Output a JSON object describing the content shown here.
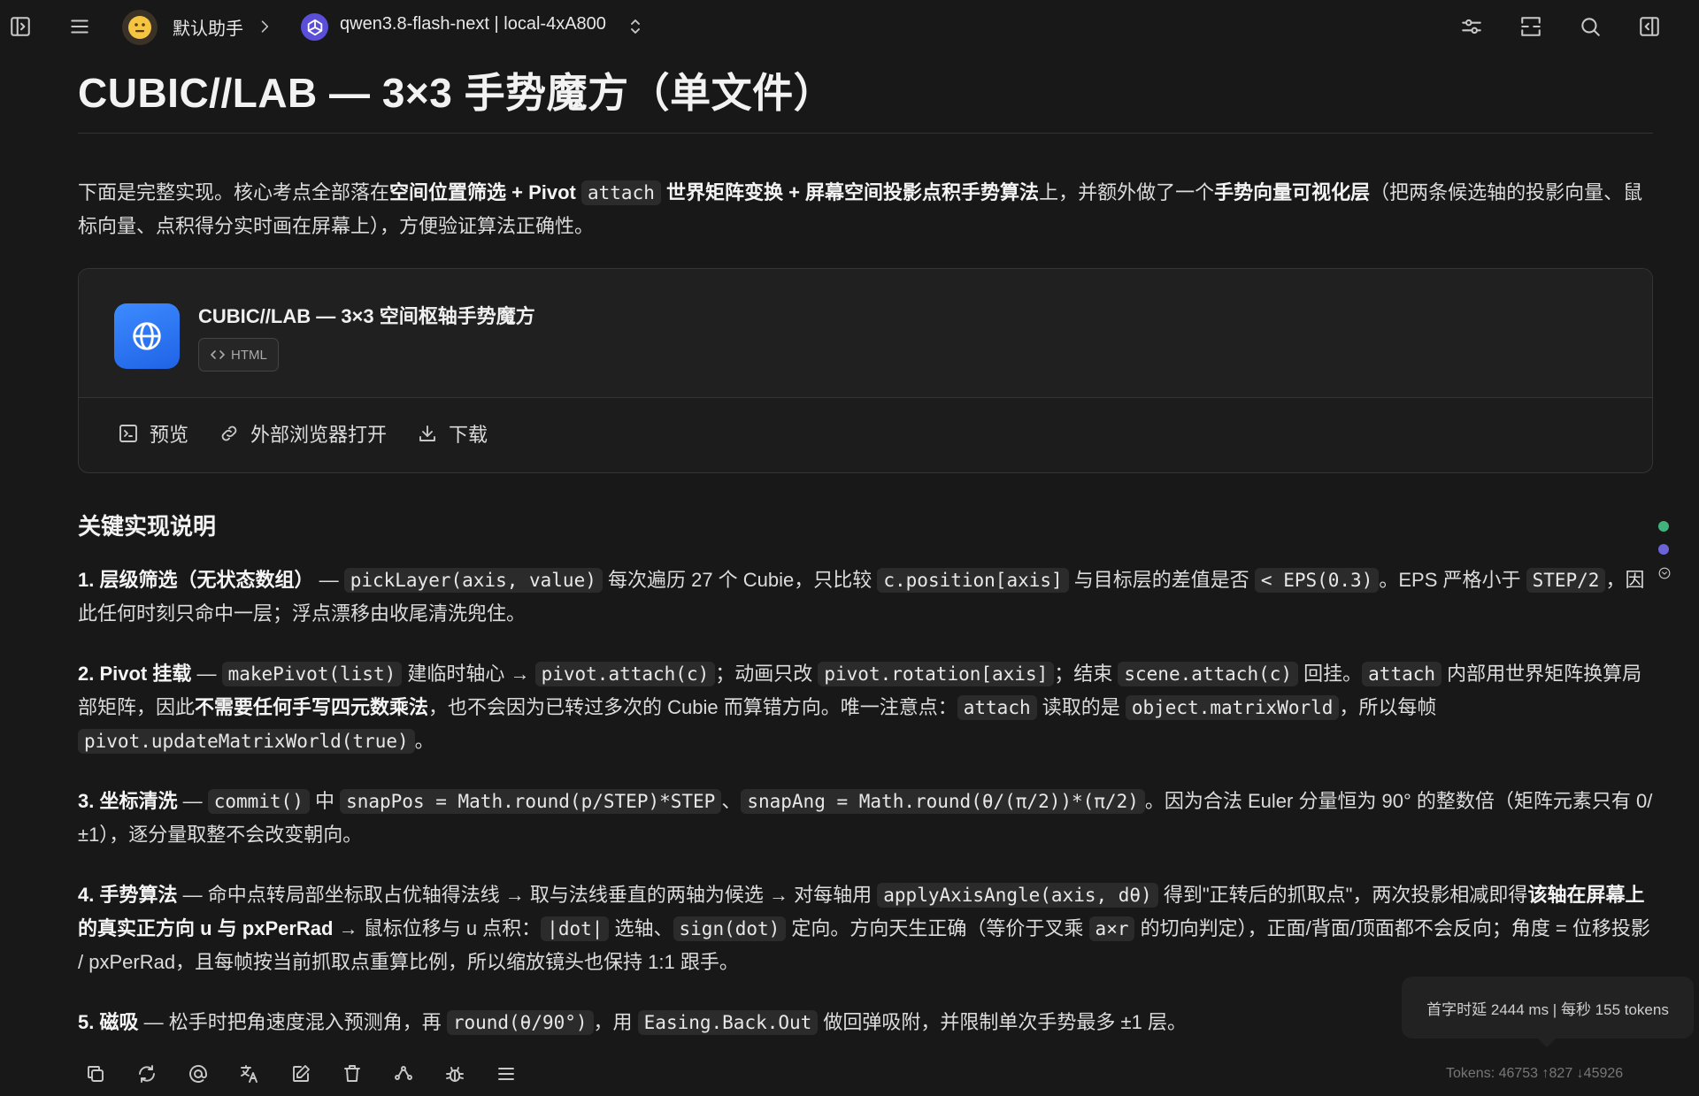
{
  "topbar": {
    "assistant_name": "默认助手",
    "model_name": "qwen3.8-flash-next | local-4xA800"
  },
  "main": {
    "title": "CUBIC//LAB — 3×3 手势魔方（单文件）",
    "intro": {
      "p1": "下面是完整实现。核心考点全部落在",
      "b1": "空间位置筛选 + Pivot",
      "c1": "attach",
      "b2": "世界矩阵变换 + 屏幕空间投影点积手势算法",
      "p2": "上，并额外做了一个",
      "b3": "手势向量可视化层",
      "p3": "（把两条候选轴的投影向量、鼠标向量、点积得分实时画在屏幕上），方便验证算法正确性。"
    },
    "artifact": {
      "title": "CUBIC//LAB — 3×3 空间枢轴手势魔方",
      "tag": "HTML",
      "preview": "预览",
      "open_external": "外部浏览器打开",
      "download": "下载"
    },
    "section_title": "关键实现说明",
    "items": [
      {
        "b1": "1. 层级筛选（无状态数组）",
        "t1": " — ",
        "c1": "pickLayer(axis, value)",
        "t2": " 每次遍历 27 个 Cubie，只比较 ",
        "c2": "c.position[axis]",
        "t3": " 与目标层的差值是否 ",
        "c3": "< EPS(0.3)",
        "t4": "。EPS 严格小于 ",
        "c4": "STEP/2",
        "t5": "，因此任何时刻只命中一层；浮点漂移由收尾清洗兜住。"
      },
      {
        "b1": "2. Pivot 挂载",
        "t1": " — ",
        "c1": "makePivot(list)",
        "t2": " 建临时轴心 → ",
        "c2": "pivot.attach(c)",
        "t3": "；动画只改 ",
        "c3": "pivot.rotation[axis]",
        "t4": "；结束 ",
        "c4": "scene.attach(c)",
        "t5": " 回挂。",
        "c5": "attach",
        "t6": " 内部用世界矩阵换算局部矩阵，因此",
        "b2": "不需要任何手写四元数乘法",
        "t7": "，也不会因为已转过多次的 Cubie 而算错方向。唯一注意点：",
        "c6": "attach",
        "t8": " 读取的是 ",
        "c7": "object.matrixWorld",
        "t9": "，所以每帧 ",
        "c8": "pivot.updateMatrixWorld(true)",
        "t10": "。"
      },
      {
        "b1": "3. 坐标清洗",
        "t1": " — ",
        "c1": "commit()",
        "t2": " 中 ",
        "c2": "snapPos = Math.round(p/STEP)*STEP",
        "t3": "、",
        "c3": "snapAng = Math.round(θ/(π/2))*(π/2)",
        "t4": "。因为合法 Euler 分量恒为 90° 的整数倍（矩阵元素只有 0/±1），逐分量取整不会改变朝向。"
      },
      {
        "b1": "4. 手势算法",
        "t1": " — 命中点转局部坐标取占优轴得法线 → 取与法线垂直的两轴为候选 → 对每轴用 ",
        "c1": "applyAxisAngle(axis, dθ)",
        "t2": " 得到\"正转后的抓取点\"，两次投影相减即得",
        "b2": "该轴在屏幕上的真实正方向 u 与 pxPerRad",
        "t3": " → 鼠标位移与 u 点积：",
        "c2": "|dot|",
        "t4": " 选轴、",
        "c3": "sign(dot)",
        "t5": " 定向。方向天生正确（等价于叉乘 ",
        "c4": "a×r",
        "t6": " 的切向判定），正面/背面/顶面都不会反向；角度 = 位移投影 / pxPerRad，且每帧按当前抓取点重算比例，所以缩放镜头也保持 1:1 跟手。"
      },
      {
        "b1": "5. 磁吸",
        "t1": " — 松手时把角速度混入预测角，再 ",
        "c1": "round(θ/90°)",
        "t2": "，用 ",
        "c2": "Easing.Back.Out",
        "t3": " 做回弹吸附，并限制单次手势最多 ±1 层。"
      }
    ]
  },
  "tooltip": "首字时延 2444 ms | 每秒 155 tokens",
  "tokens": "Tokens: 46753 ↑827 ↓45926",
  "colors": {
    "background": "#181818",
    "artifact_icon": "#2f78f5",
    "model_logo": "#5b4fd8",
    "dot_green": "#3fb37a",
    "dot_purple": "#6c63d9"
  }
}
